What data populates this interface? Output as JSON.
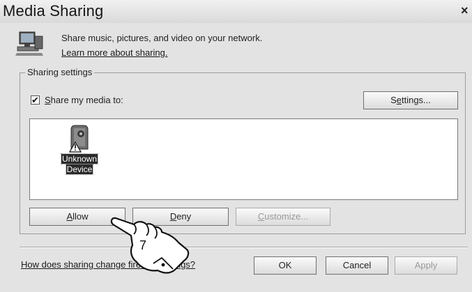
{
  "window": {
    "title": "Media Sharing",
    "close_glyph": "×"
  },
  "header": {
    "icon": "computer-network-icon",
    "description": "Share music, pictures, and video on your network.",
    "learn_more_link": "Learn more about sharing."
  },
  "sharing_settings": {
    "group_label": "Sharing settings",
    "share_checkbox": {
      "checked": true,
      "check_glyph": "✔",
      "label": "Share my media to:"
    },
    "settings_button": "Settings...",
    "devices": [
      {
        "name_line1": "Unknown",
        "name_line2": "Device",
        "icon": "unknown-device-warning-icon",
        "selected": true
      }
    ],
    "allow_button": "Allow",
    "deny_button": "Deny",
    "customize_button": "Customize...",
    "customize_enabled": false
  },
  "footer": {
    "help_link": "How does sharing change firewall settings?",
    "ok_button": "OK",
    "cancel_button": "Cancel",
    "apply_button": "Apply",
    "apply_enabled": false
  },
  "callout": {
    "step_number": "7",
    "icon": "pointing-hand-icon"
  }
}
